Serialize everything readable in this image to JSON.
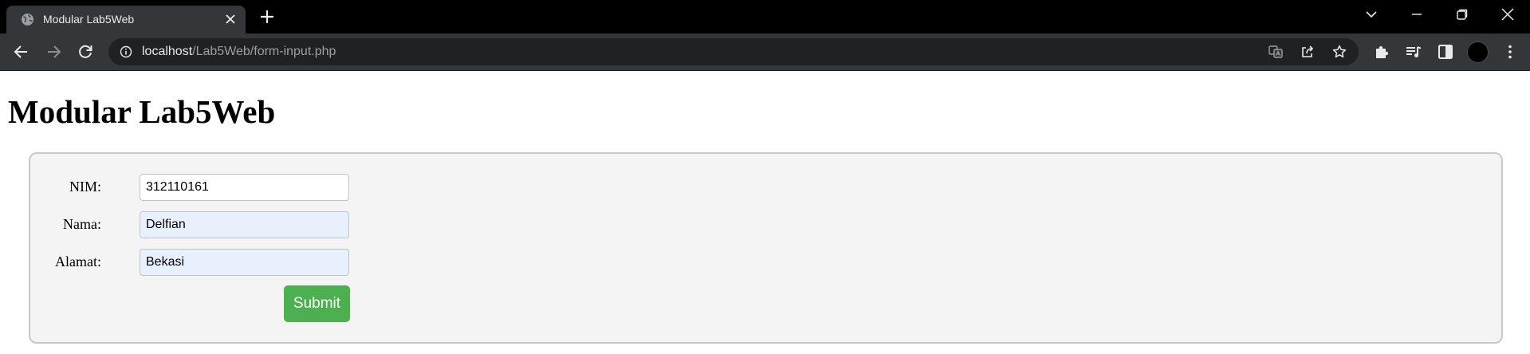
{
  "browser": {
    "tab": {
      "title": "Modular Lab5Web",
      "favicon": "globe-icon"
    },
    "url": {
      "host": "localhost",
      "path": "/Lab5Web/form-input.php"
    },
    "icons": {
      "back": "arrow-left-icon",
      "forward": "arrow-right-icon",
      "reload": "reload-icon",
      "site_info": "info-icon",
      "translate": "translate-icon",
      "share": "share-icon",
      "bookmark": "star-icon",
      "extensions": "puzzle-icon",
      "media": "playlist-icon",
      "side_panel": "side-panel-icon",
      "menu": "kebab-icon"
    },
    "colors": {
      "tabstrip": "#000000",
      "toolbar": "#35363a",
      "omnibox": "#202124"
    }
  },
  "page": {
    "title": "Modular Lab5Web",
    "form": {
      "fields": [
        {
          "label": "NIM:",
          "value": "312110161"
        },
        {
          "label": "Nama:",
          "value": "Delfian"
        },
        {
          "label": "Alamat:",
          "value": "Bekasi"
        }
      ],
      "submit_label": "Submit"
    },
    "colors": {
      "submit": "#4caf50",
      "panel_bg": "#f4f4f4",
      "autofill_bg": "#e8f0fe"
    }
  }
}
